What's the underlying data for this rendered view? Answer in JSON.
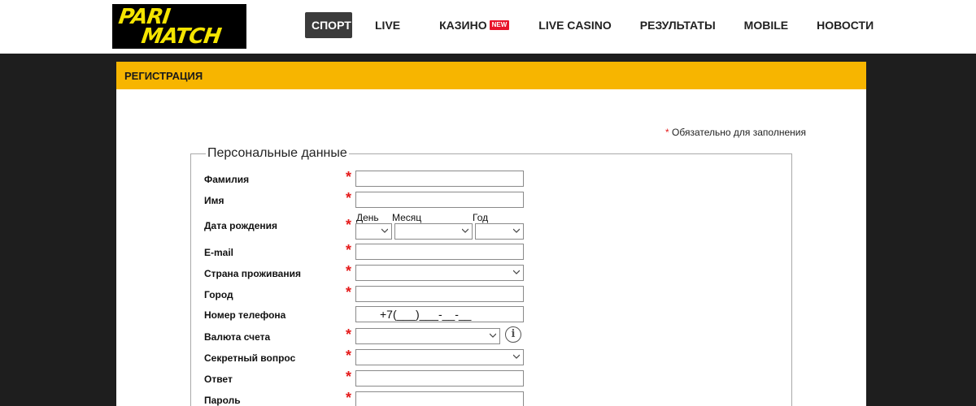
{
  "header": {
    "logo": {
      "line1": "PARI",
      "line2": "MATCH"
    },
    "nav": [
      {
        "label": "СПОРТ",
        "active": true
      },
      {
        "label": "LIVE"
      },
      {
        "label": "КАЗИНО",
        "badge": "NEW"
      },
      {
        "label": "LIVE CASINO"
      },
      {
        "label": "РЕЗУЛЬТАТЫ"
      },
      {
        "label": "MOBILE"
      },
      {
        "label": "НОВОСТИ"
      }
    ]
  },
  "colors": {
    "accent": "#f7b500",
    "brand_yellow": "#f4e400",
    "required": "#e51b1b",
    "badge": "#e8142a"
  },
  "panel": {
    "title": "РЕГИСТРАЦИЯ"
  },
  "form": {
    "required_star": "*",
    "required_note": "Обязательно для заполнения",
    "legend": "Персональные данные",
    "fields": {
      "last_name": {
        "label": "Фамилия",
        "value": ""
      },
      "first_name": {
        "label": "Имя",
        "value": ""
      },
      "birth_date": {
        "label": "Дата рождения",
        "day_label": "День",
        "month_label": "Месяц",
        "year_label": "Год"
      },
      "email": {
        "label": "E-mail",
        "value": ""
      },
      "country": {
        "label": "Страна проживания",
        "value": ""
      },
      "city": {
        "label": "Город",
        "value": ""
      },
      "phone": {
        "label": "Номер телефона",
        "value": "+7(___)___-__-__"
      },
      "currency": {
        "label": "Валюта счета",
        "value": "",
        "info_icon": "info-icon"
      },
      "secret_question": {
        "label": "Секретный вопрос",
        "value": ""
      },
      "answer": {
        "label": "Ответ",
        "value": ""
      },
      "password": {
        "label": "Пароль",
        "value": ""
      }
    }
  }
}
